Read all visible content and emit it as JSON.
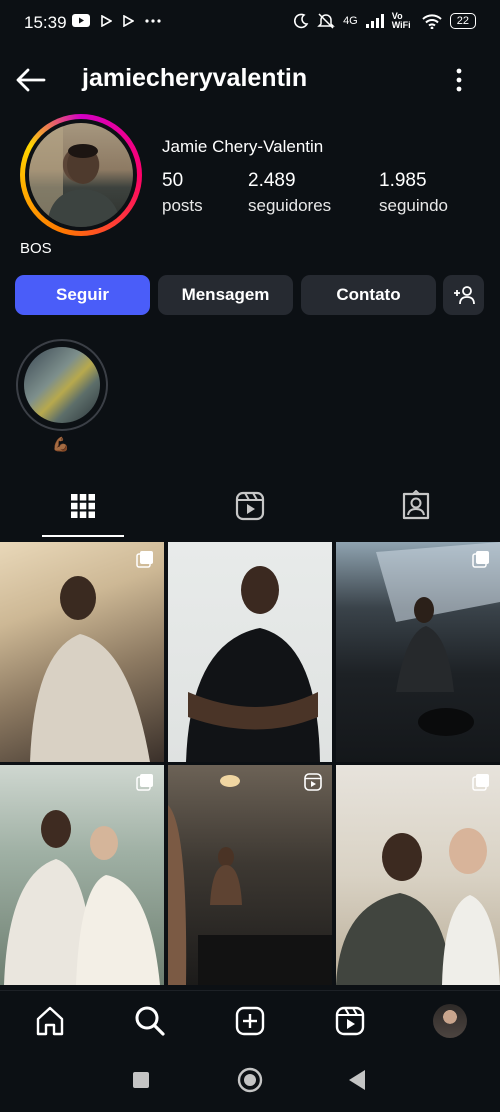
{
  "status_bar": {
    "time": "15:39",
    "network": "4G",
    "volte": "Vo WiFi",
    "battery": "22"
  },
  "header": {
    "username": "jamiecheryvalentin"
  },
  "profile": {
    "full_name": "Jamie Chery-Valentin",
    "bio": "BOS",
    "stats": [
      {
        "value": "50",
        "label": "posts"
      },
      {
        "value": "2.489",
        "label": "seguidores"
      },
      {
        "value": "1.985",
        "label": "seguindo"
      }
    ]
  },
  "actions": {
    "follow": "Seguir",
    "message": "Mensagem",
    "contact": "Contato"
  },
  "highlights": [
    {
      "label": "💪🏾"
    }
  ],
  "tabs": [
    "grid-icon",
    "reels-icon",
    "tagged-icon"
  ],
  "colors": {
    "background": "#0c1014",
    "button": "#262a31",
    "follow_button": "#4a5df9"
  }
}
